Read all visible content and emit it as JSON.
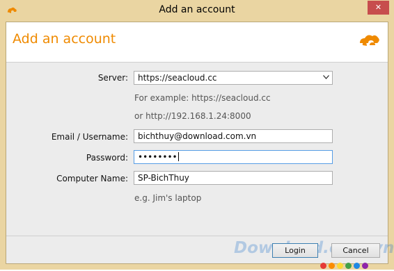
{
  "window": {
    "title": "Add an account",
    "close_glyph": "✕",
    "app_icon": "seafile-logo-icon"
  },
  "header": {
    "title": "Add an account",
    "logo_icon": "seafile-logo-icon"
  },
  "form": {
    "server": {
      "label": "Server:",
      "value": "https://seacloud.cc",
      "hint1": "For example: https://seacloud.cc",
      "hint2": "or http://192.168.1.24:8000"
    },
    "email": {
      "label": "Email / Username:",
      "value": "bichthuy@download.com.vn"
    },
    "password": {
      "label": "Password:",
      "value": "••••••••"
    },
    "computer_name": {
      "label": "Computer Name:",
      "value": "SP-BichThuy",
      "hint": "e.g. Jim's laptop"
    }
  },
  "buttons": {
    "login": "Login",
    "cancel": "Cancel"
  },
  "watermark": {
    "text": "Download.com.vn",
    "dot_colors": [
      "#e53935",
      "#fb8c00",
      "#fdd835",
      "#43a047",
      "#1e88e5",
      "#8e24aa"
    ]
  },
  "colors": {
    "accent": "#ef8a00",
    "frame": "#ead5a2",
    "focus": "#569de5"
  }
}
